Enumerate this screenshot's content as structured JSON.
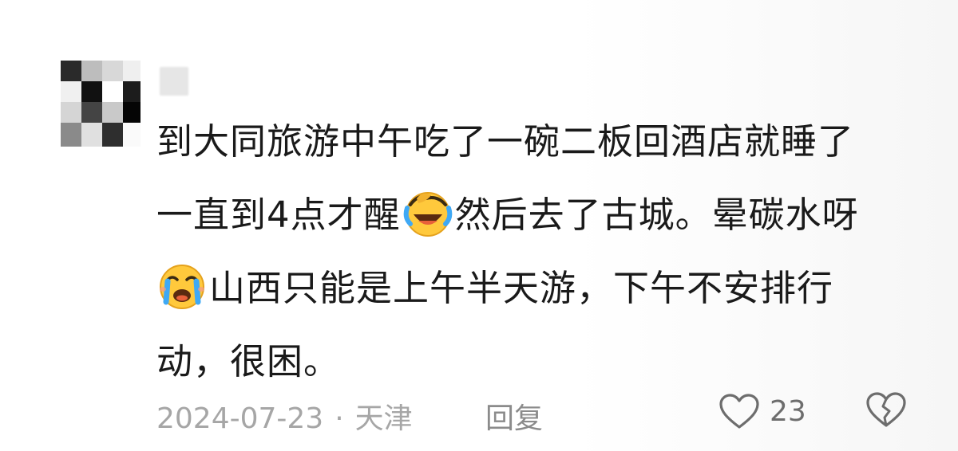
{
  "comment": {
    "lines": [
      {
        "text": "到大同旅游中午吃了一碗二板回酒店就睡了"
      },
      {
        "before": "一直到4点才醒",
        "emoji": "laughing-crying-emoji",
        "after": "然后去了古城。晕碳水呀"
      },
      {
        "emoji": "sobbing-face-emoji",
        "after": "山西只能是上午半天游，下午不安排行"
      },
      {
        "text": "动，很困。"
      }
    ]
  },
  "footer": {
    "date": "2024-07-23",
    "separator": "·",
    "location": "天津",
    "reply_label": "回复",
    "like_count": "23"
  },
  "icons": {
    "like": "heart-outline-icon",
    "dislike": "broken-heart-icon"
  },
  "colors": {
    "text": "#1a1a1a",
    "meta": "#a6a6a6",
    "icon": "#6d6d6d"
  }
}
